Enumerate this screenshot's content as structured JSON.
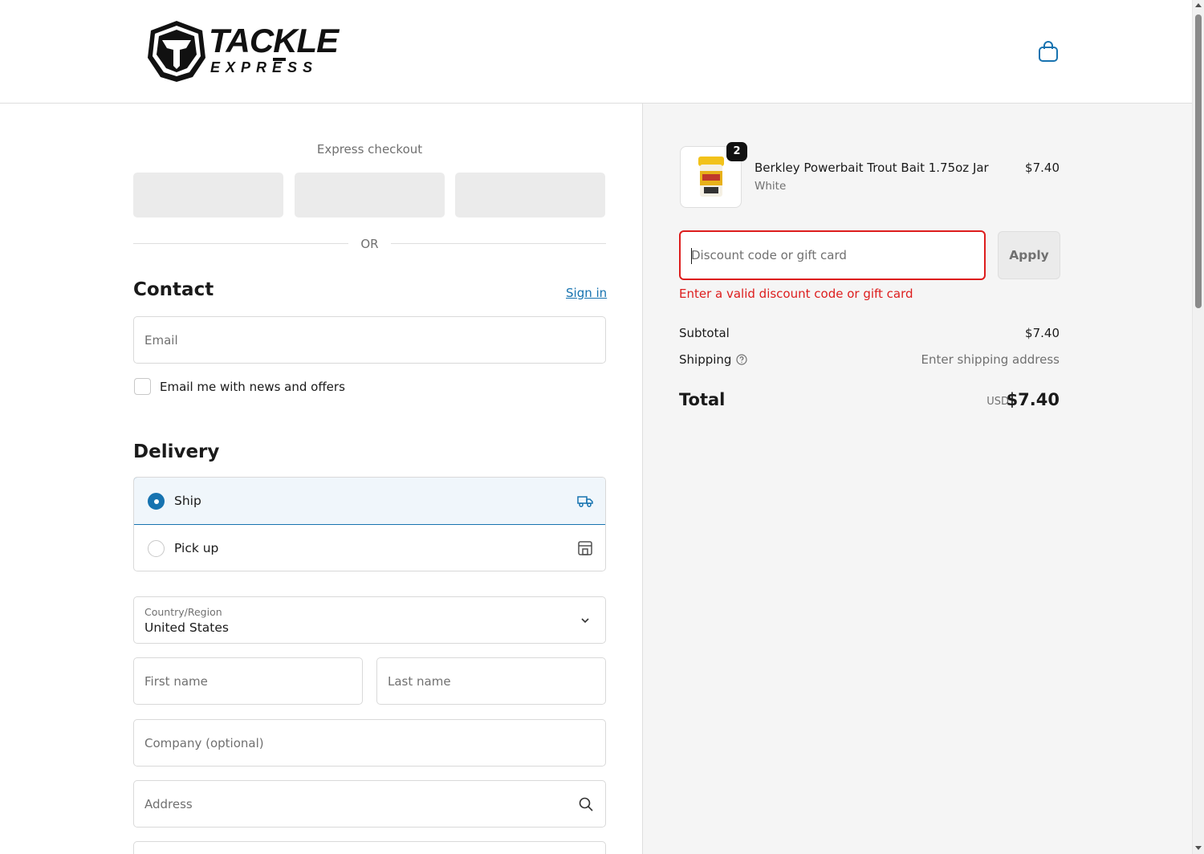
{
  "header": {
    "logo_line1": "TACKLE",
    "logo_line2": "EXPRESS",
    "cart_icon": "shopping-bag-icon"
  },
  "express": {
    "label": "Express checkout",
    "or_label": "OR"
  },
  "contact": {
    "title": "Contact",
    "sign_in": "Sign in",
    "email_placeholder": "Email",
    "newsletter_label": "Email me with news and offers",
    "newsletter_checked": false
  },
  "delivery": {
    "title": "Delivery",
    "options": [
      {
        "label": "Ship",
        "icon": "truck-icon",
        "selected": true
      },
      {
        "label": "Pick up",
        "icon": "store-icon",
        "selected": false
      }
    ],
    "country_label": "Country/Region",
    "country_value": "United States",
    "first_name_placeholder": "First name",
    "last_name_placeholder": "Last name",
    "company_placeholder": "Company (optional)",
    "address_placeholder": "Address"
  },
  "order": {
    "item": {
      "quantity": "2",
      "name": "Berkley Powerbait Trout Bait 1.75oz Jar",
      "variant": "White",
      "price": "$7.40"
    },
    "discount_placeholder": "Discount code or gift card",
    "apply_label": "Apply",
    "discount_error": "Enter a valid discount code or gift card",
    "subtotal_label": "Subtotal",
    "subtotal_value": "$7.40",
    "shipping_label": "Shipping",
    "shipping_value": "Enter shipping address",
    "total_label": "Total",
    "total_currency": "USD",
    "total_value": "$7.40"
  },
  "colors": {
    "accent": "#1773b0",
    "error": "#dd1d1d",
    "summary_bg": "#f5f5f5"
  }
}
